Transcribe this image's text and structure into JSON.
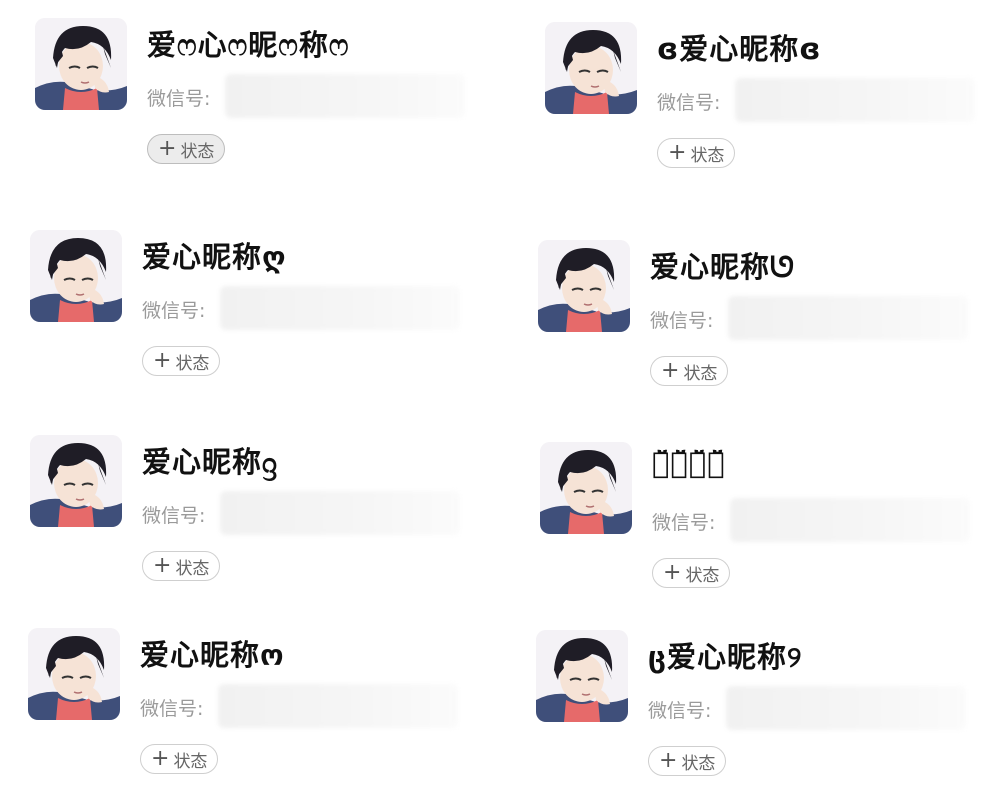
{
  "contacts": [
    {
      "nickname": "爱ෆ心ෆ昵ෆ称ෆ",
      "wechat_label": "微信号:",
      "status_label": "状态",
      "status_plus": "+"
    },
    {
      "nickname": "ɞ爱心昵称ɞ",
      "wechat_label": "微信号:",
      "status_label": "状态",
      "status_plus": "+"
    },
    {
      "nickname": "爱心昵称ღ",
      "wechat_label": "微信号:",
      "status_label": "状态",
      "status_plus": "+"
    },
    {
      "nickname": "爱心昵称ᘎ",
      "wechat_label": "微信号:",
      "status_label": "状态",
      "status_plus": "+"
    },
    {
      "nickname": "爱心昵称ᦋ",
      "wechat_label": "微信号:",
      "status_label": "状态",
      "status_plus": "+"
    },
    {
      "nickname": "爱̆̈心̆̈昵̆̈称̆̈",
      "wechat_label": "微信号:",
      "status_label": "状态",
      "status_plus": "+"
    },
    {
      "nickname": "爱心昵称ო",
      "wechat_label": "微信号:",
      "status_label": "状态",
      "status_plus": "+"
    },
    {
      "nickname": "ც爱心昵称୨",
      "wechat_label": "微信号:",
      "status_label": "状态",
      "status_plus": "+"
    }
  ]
}
